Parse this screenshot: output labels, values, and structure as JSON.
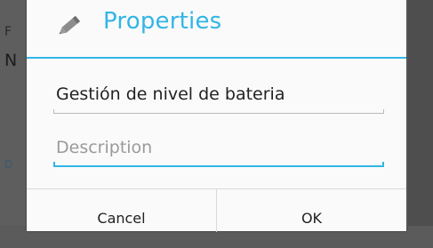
{
  "dialog": {
    "title": "Properties",
    "icon": "pencil-icon",
    "accent_color": "#33b5e5",
    "name_field": {
      "value": "Gestión de nivel de bateria"
    },
    "description_field": {
      "placeholder": "Description",
      "value": ""
    },
    "buttons": {
      "cancel": "Cancel",
      "ok": "OK"
    }
  },
  "background": {
    "glyphs": [
      "F",
      "N",
      "D"
    ]
  }
}
